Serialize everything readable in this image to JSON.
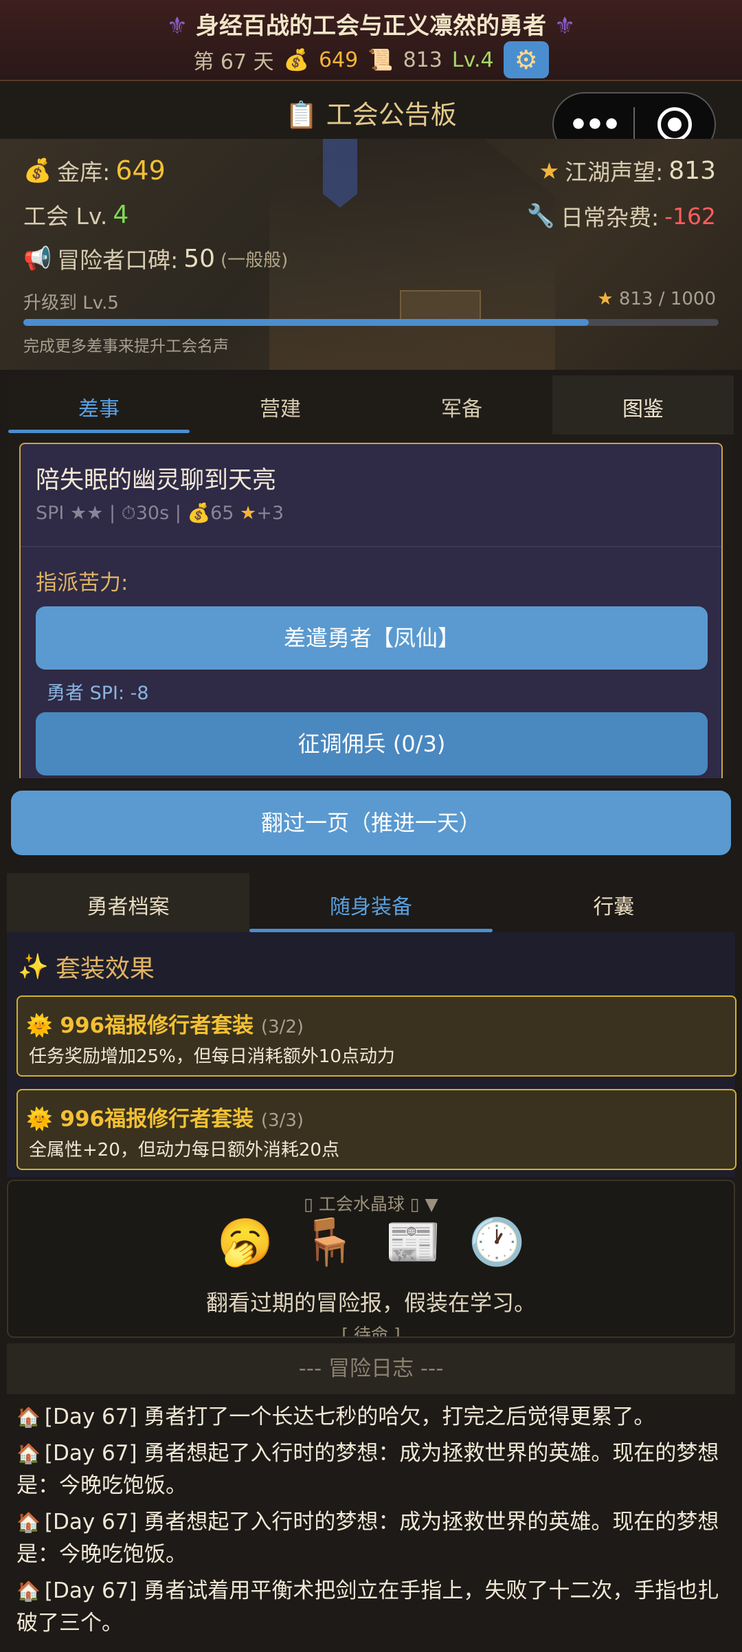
{
  "header": {
    "title": "身经百战的工会与正义凛然的勇者",
    "fleur": "⚜",
    "day_label": "第 67 天",
    "gold": "649",
    "scroll_value": "813",
    "level": "Lv.4",
    "gear_glyph": "⚙"
  },
  "board": {
    "title": "工会公告板",
    "clipboard_glyph": "📋"
  },
  "capsule": {
    "more_glyph": "•••"
  },
  "guild": {
    "treasury_label": "金库:",
    "treasury_value": "649",
    "reputation_label": "江湖声望:",
    "reputation_value": "813",
    "level_label": "工会 Lv.",
    "level_value": "4",
    "upkeep_label": "日常杂费:",
    "upkeep_value": "-162",
    "word_of_mouth_label": "冒险者口碑:",
    "word_of_mouth_value": "50",
    "word_of_mouth_tier": "(一般般)",
    "upgrade_label": "升级到 Lv.5",
    "progress_text": "813 / 1000",
    "progress_fraction": 0.813,
    "hint": "完成更多差事来提升工会名声"
  },
  "main_tabs": [
    {
      "label": "差事"
    },
    {
      "label": "营建"
    },
    {
      "label": "军备"
    },
    {
      "label": "图鉴"
    }
  ],
  "quest": {
    "title": "陪失眠的幽灵聊到天亮",
    "meta_stat": "SPI ★★",
    "meta_time": "30s",
    "meta_gold": "65",
    "meta_rep": "+3",
    "assign_label": "指派苦力:",
    "hero_button": "差遣勇者【凤仙】",
    "hero_spi": "勇者 SPI: -8",
    "merc_button": "征调佣兵 (0/3)"
  },
  "next_day_button": "翻过一页（推进一天）",
  "hero_tabs": [
    {
      "label": "勇者档案"
    },
    {
      "label": "随身装备"
    },
    {
      "label": "行囊"
    }
  ],
  "set_effects": {
    "header": "套装效果",
    "items": [
      {
        "name": "996福报修行者套装",
        "count": "(3/2)",
        "desc": "任务奖励增加25%，但每日消耗额外10点动力"
      },
      {
        "name": "996福报修行者套装",
        "count": "(3/3)",
        "desc": "全属性+20，但动力每日额外消耗20点"
      }
    ]
  },
  "crystal_ball": {
    "header": "▯ 工会水晶球 ▯ ▼",
    "icons": [
      "🥱",
      "🪑",
      "📰",
      "🕐"
    ],
    "text": "翻看过期的冒险报，假装在学习。",
    "status": "[ 待命 ]"
  },
  "log": {
    "header": "--- 冒险日志 ---",
    "entries": [
      "[Day 67] 勇者打了一个长达七秒的哈欠，打完之后觉得更累了。",
      "[Day 67] 勇者想起了入行时的梦想：成为拯救世界的英雄。现在的梦想是：今晚吃饱饭。",
      "[Day 67] 勇者想起了入行时的梦想：成为拯救世界的英雄。现在的梦想是：今晚吃饱饭。",
      "[Day 67] 勇者试着用平衡术把剑立在手指上，失败了十二次，手指也扎破了三个。"
    ]
  }
}
